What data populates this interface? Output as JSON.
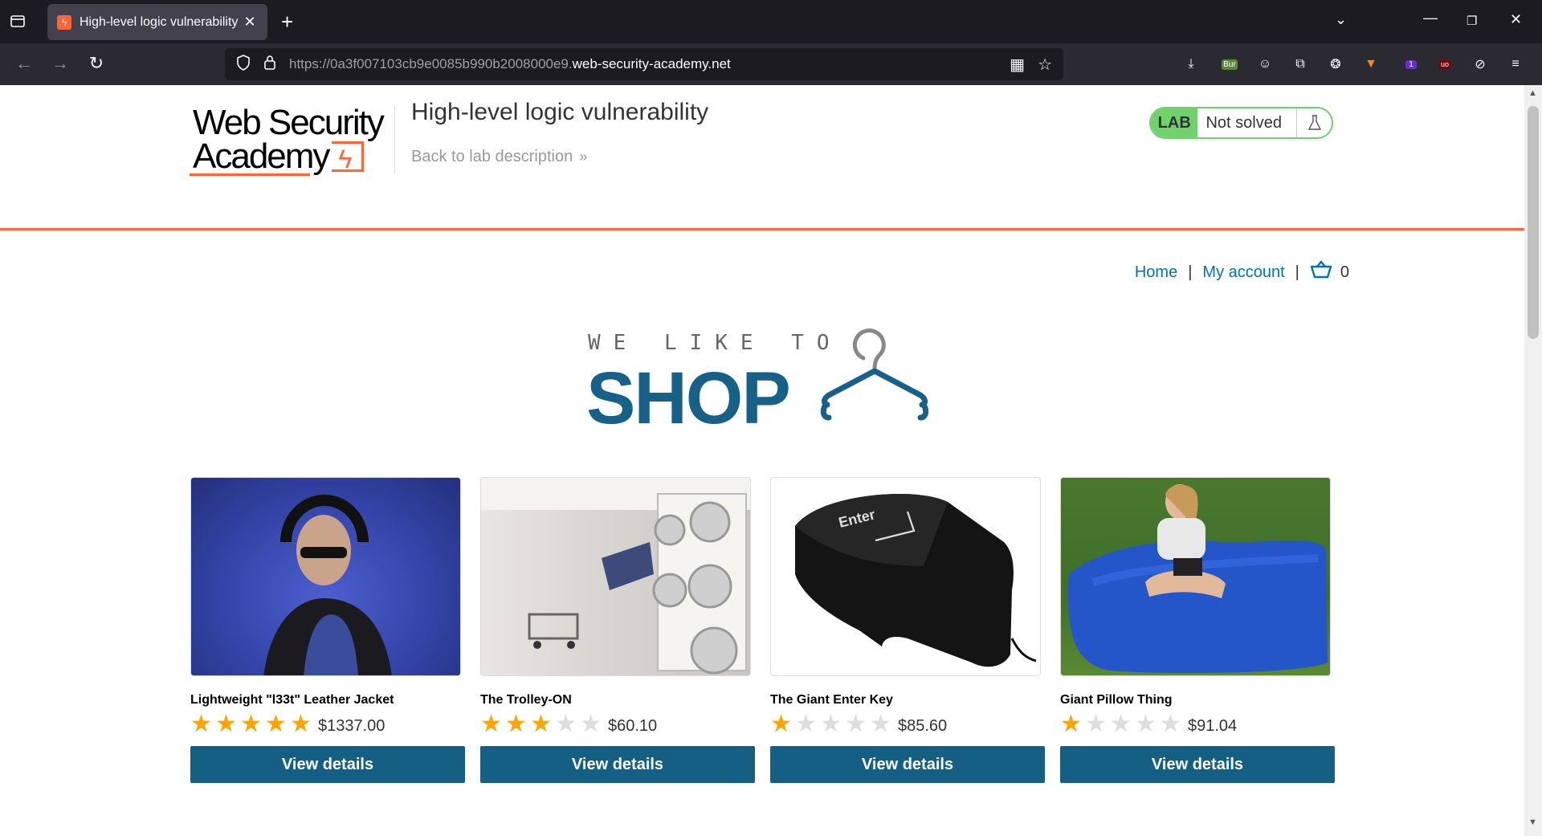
{
  "browser": {
    "tab_title": "High-level logic vulnerability",
    "url_prefix": "https://0a3f007103cb9e0085b990b2008000e9.",
    "url_domain": "web-security-academy.net",
    "ext_burp_label": "Bur",
    "ext_badge_count": "1",
    "ext_ublock_label": "uo"
  },
  "header": {
    "logo_line1": "Web Security",
    "logo_line2": "Academy",
    "lab_title": "High-level logic vulnerability",
    "back_link": "Back to lab description",
    "lab_label": "LAB",
    "lab_status": "Not solved"
  },
  "nav": {
    "home": "Home",
    "my_account": "My account",
    "cart_count": "0"
  },
  "banner": {
    "tagline": "WE LIKE TO",
    "shop": "SHOP"
  },
  "products": [
    {
      "name": "Lightweight \"l33t\" Leather Jacket",
      "rating": 5,
      "price": "$1337.00",
      "button": "View details"
    },
    {
      "name": "The Trolley-ON",
      "rating": 3,
      "price": "$60.10",
      "button": "View details"
    },
    {
      "name": "The Giant Enter Key",
      "rating": 1,
      "price": "$85.60",
      "button": "View details"
    },
    {
      "name": "Giant Pillow Thing",
      "rating": 1,
      "price": "$91.04",
      "button": "View details"
    }
  ],
  "colors": {
    "accent": "#ff6633",
    "button": "#155f84",
    "link": "#0071bc",
    "lab_green": "#70d16d",
    "star": "#ffa500"
  }
}
